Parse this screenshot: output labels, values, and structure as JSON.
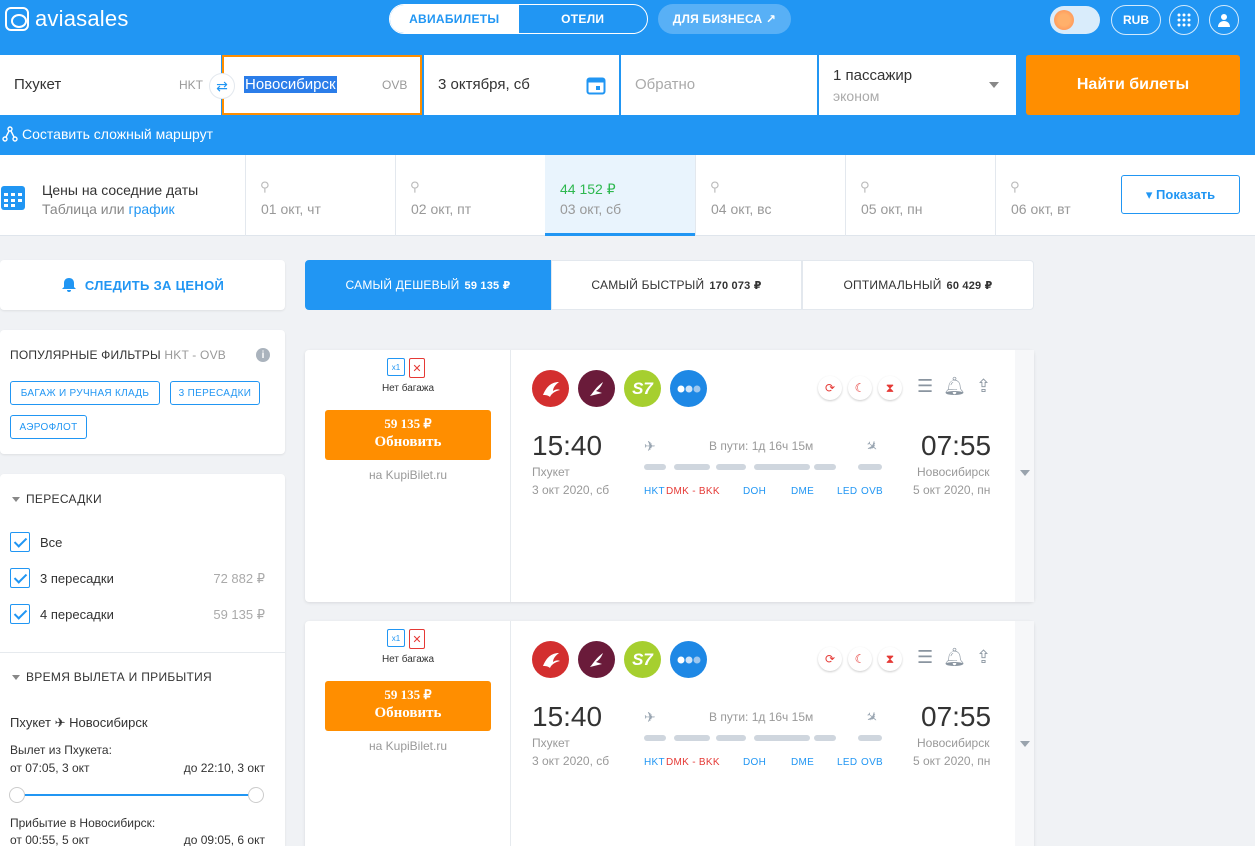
{
  "header": {
    "logo": "aviasales",
    "tabs": [
      "АВИАБИЛЕТЫ",
      "ОТЕЛИ"
    ],
    "business": "ДЛЯ БИЗНЕСА ↗",
    "currency": "RUB"
  },
  "search": {
    "origin": "Пхукет",
    "origin_code": "HKT",
    "destination": "Новосибирск",
    "destination_code": "OVB",
    "depart_date": "3 октября, сб",
    "return_placeholder": "Обратно",
    "passengers": "1 пассажир",
    "cabin": "эконом",
    "find_button": "Найти билеты",
    "complex_route": "Составить сложный маршрут"
  },
  "dates_strip": {
    "title": "Цены на соседние даты",
    "sub_table": "Таблица",
    "sub_or": "или",
    "sub_graph": "график",
    "columns": [
      {
        "label": "01 окт, чт",
        "price": ""
      },
      {
        "label": "02 окт, пт",
        "price": ""
      },
      {
        "label": "03 окт, сб",
        "price": "44 152 ₽"
      },
      {
        "label": "04 окт, вс",
        "price": ""
      },
      {
        "label": "05 окт, пн",
        "price": ""
      },
      {
        "label": "06 окт, вт",
        "price": ""
      }
    ],
    "show_button": "▾ Показать"
  },
  "left": {
    "watch_price": "СЛЕДИТЬ ЗА ЦЕНОЙ",
    "popular_title": "ПОПУЛЯРНЫЕ ФИЛЬТРЫ",
    "popular_route": "HKT - OVB",
    "chips": [
      "БАГАЖ И РУЧНАЯ КЛАДЬ",
      "3 ПЕРЕСАДКИ",
      "АЭРОФЛОТ"
    ],
    "stops_title": "ПЕРЕСАДКИ",
    "stops": [
      {
        "label": "Все",
        "price": ""
      },
      {
        "label": "3 пересадки",
        "price": "72 882 ₽"
      },
      {
        "label": "4 пересадки",
        "price": "59 135 ₽"
      }
    ],
    "times_title": "ВРЕМЯ ВЫЛЕТА И ПРИБЫТИЯ",
    "route_from": "Пхукет",
    "route_to": "Новосибирск",
    "depart_title": "Вылет из Пхукета:",
    "depart_from": "от 07:05, 3 окт",
    "depart_to": "до 22:10, 3 окт",
    "arrive_title": "Прибытие в Новосибирск:",
    "arrive_from": "от 00:55, 5 окт",
    "arrive_to": "до 09:05, 6 окт"
  },
  "sort": [
    {
      "label": "САМЫЙ ДЕШЕВЫЙ",
      "price": "59 135 ₽"
    },
    {
      "label": "САМЫЙ БЫСТРЫЙ",
      "price": "170 073 ₽"
    },
    {
      "label": "ОПТИМАЛЬНЫЙ",
      "price": "60 429 ₽"
    }
  ],
  "ticket": {
    "bag_label": "x1",
    "no_bag": "Нет багажа",
    "price": "59 135 ₽",
    "update": "Обновить",
    "seller": "на KupiBilet.ru",
    "s7_label": "S7",
    "dep_time": "15:40",
    "arr_time": "07:55",
    "dep_city": "Пхукет",
    "arr_city": "Новосибирск",
    "dep_date": "3 окт 2020, сб",
    "arr_date": "5 окт 2020, пн",
    "duration": "В пути: 1д 16ч 15м",
    "airports": [
      "HKT",
      "DMK - BKK",
      "DOH",
      "DME",
      "LED",
      "OVB"
    ]
  },
  "colors": {
    "brand": "#2196f3",
    "accent": "#ff8e00",
    "price_green": "#2eb84f"
  }
}
